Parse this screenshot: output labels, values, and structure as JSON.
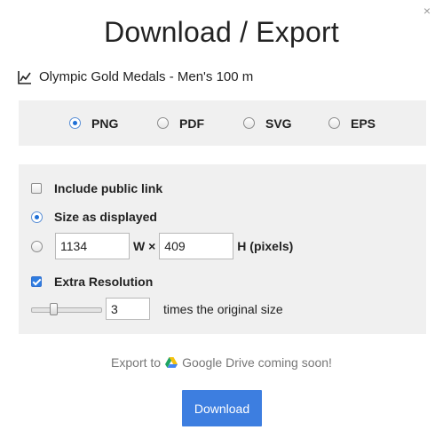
{
  "dialog": {
    "close_glyph": "×",
    "title": "Download / Export",
    "chart_name": "Olympic Gold Medals - Men's 100 m"
  },
  "formats": {
    "options": [
      {
        "label": "PNG",
        "selected": true
      },
      {
        "label": "PDF",
        "selected": false
      },
      {
        "label": "SVG",
        "selected": false
      },
      {
        "label": "EPS",
        "selected": false
      }
    ]
  },
  "options": {
    "public_link": {
      "label": "Include public link",
      "checked": false
    },
    "size_as_displayed": {
      "label": "Size as displayed",
      "selected": true
    },
    "custom_size": {
      "selected": false,
      "width_value": "1134",
      "width_suffix": "W ×",
      "height_value": "409",
      "height_suffix": "H (pixels)"
    },
    "extra_resolution": {
      "label": "Extra Resolution",
      "checked": true
    },
    "scale": {
      "value": "3",
      "suffix": "times the original size",
      "slider_fraction": 0.3
    }
  },
  "google_drive": {
    "prefix": "Export to",
    "suffix": "Google Drive coming soon!"
  },
  "download_button": {
    "label": "Download"
  },
  "colors": {
    "accent": "#3d7ee0",
    "panel_bg": "#f0f0f0"
  }
}
